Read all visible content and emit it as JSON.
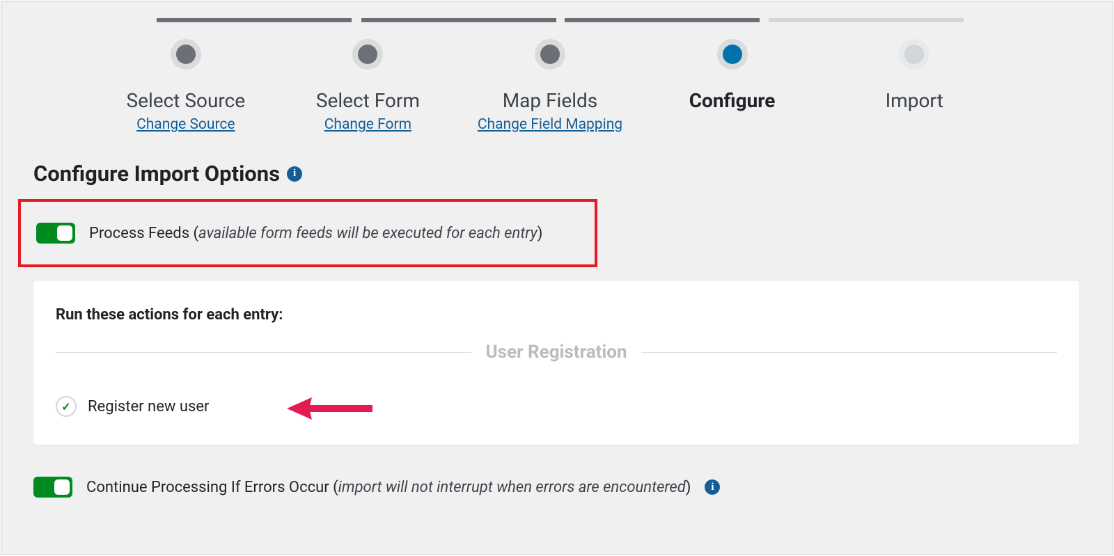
{
  "stepper": {
    "steps": [
      {
        "label": "Select Source",
        "link": "Change Source",
        "state": "done"
      },
      {
        "label": "Select Form",
        "link": "Change Form",
        "state": "done"
      },
      {
        "label": "Map Fields",
        "link": "Change Field Mapping",
        "state": "done"
      },
      {
        "label": "Configure",
        "link": "",
        "state": "current"
      },
      {
        "label": "Import",
        "link": "",
        "state": "future"
      }
    ]
  },
  "heading": {
    "title": "Configure Import Options"
  },
  "options": {
    "process_feeds": {
      "label": "Process Feeds ",
      "hint_open": "(",
      "hint": "available form feeds will be executed for each entry",
      "hint_close": ")",
      "enabled": true
    },
    "continue_on_error": {
      "label": "Continue Processing If Errors Occur ",
      "hint_open": "(",
      "hint": "import will not interrupt when errors are encountered",
      "hint_close": ")",
      "enabled": true
    }
  },
  "feeds_panel": {
    "title": "Run these actions for each entry:",
    "section": "User Registration",
    "actions": [
      {
        "label": "Register new user",
        "checked": true
      }
    ]
  },
  "icons": {
    "info": "i",
    "check": "✓"
  }
}
